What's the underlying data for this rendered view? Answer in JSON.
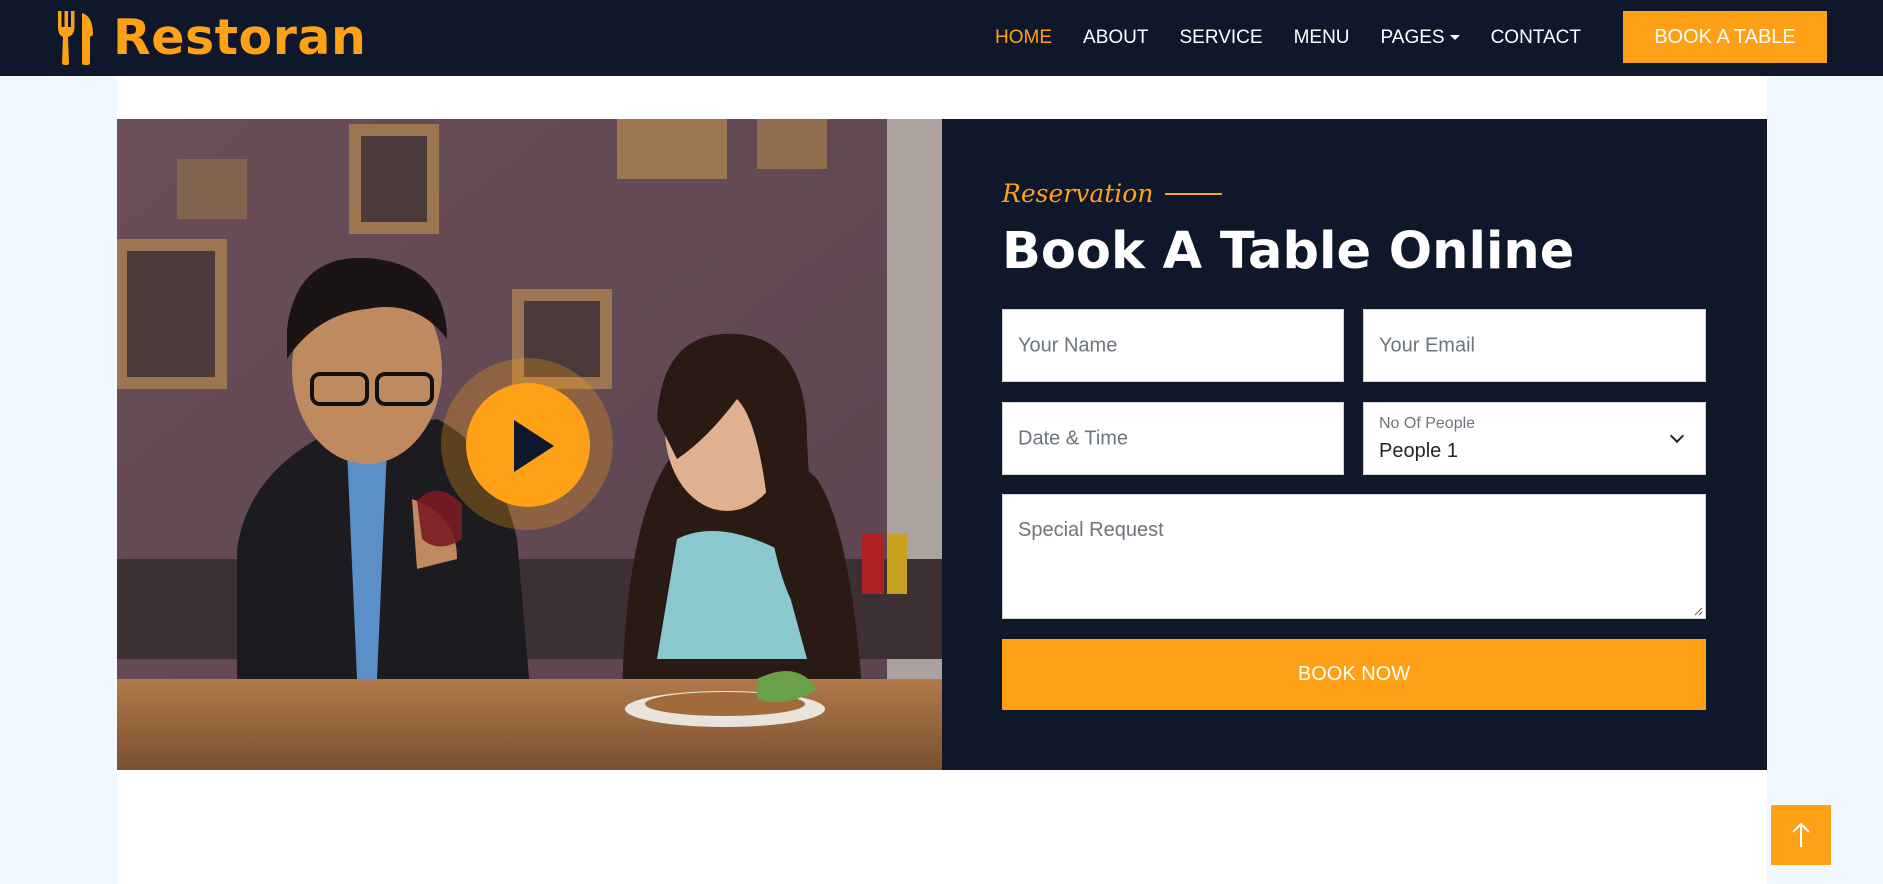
{
  "brand": {
    "name": "Restoran",
    "icon": "utensils-icon",
    "color": "#fea116"
  },
  "nav": {
    "items": [
      {
        "label": "HOME",
        "active": true
      },
      {
        "label": "ABOUT",
        "active": false
      },
      {
        "label": "SERVICE",
        "active": false
      },
      {
        "label": "MENU",
        "active": false
      },
      {
        "label": "PAGES",
        "active": false,
        "dropdown": true
      },
      {
        "label": "CONTACT",
        "active": false
      }
    ],
    "cta_label": "BOOK A TABLE"
  },
  "reservation": {
    "eyebrow": "Reservation",
    "title": "Book A Table Online",
    "fields": {
      "name_placeholder": "Your Name",
      "email_placeholder": "Your Email",
      "datetime_placeholder": "Date & Time",
      "people_label": "No Of People",
      "people_value": "People 1",
      "request_placeholder": "Special Request"
    },
    "submit_label": "BOOK NOW"
  },
  "video": {
    "play_icon": "play-icon"
  },
  "back_to_top": {
    "icon": "arrow-up-icon"
  },
  "colors": {
    "primary": "#fea116",
    "dark": "#0f172b",
    "page_bg": "#f1f8ff"
  }
}
